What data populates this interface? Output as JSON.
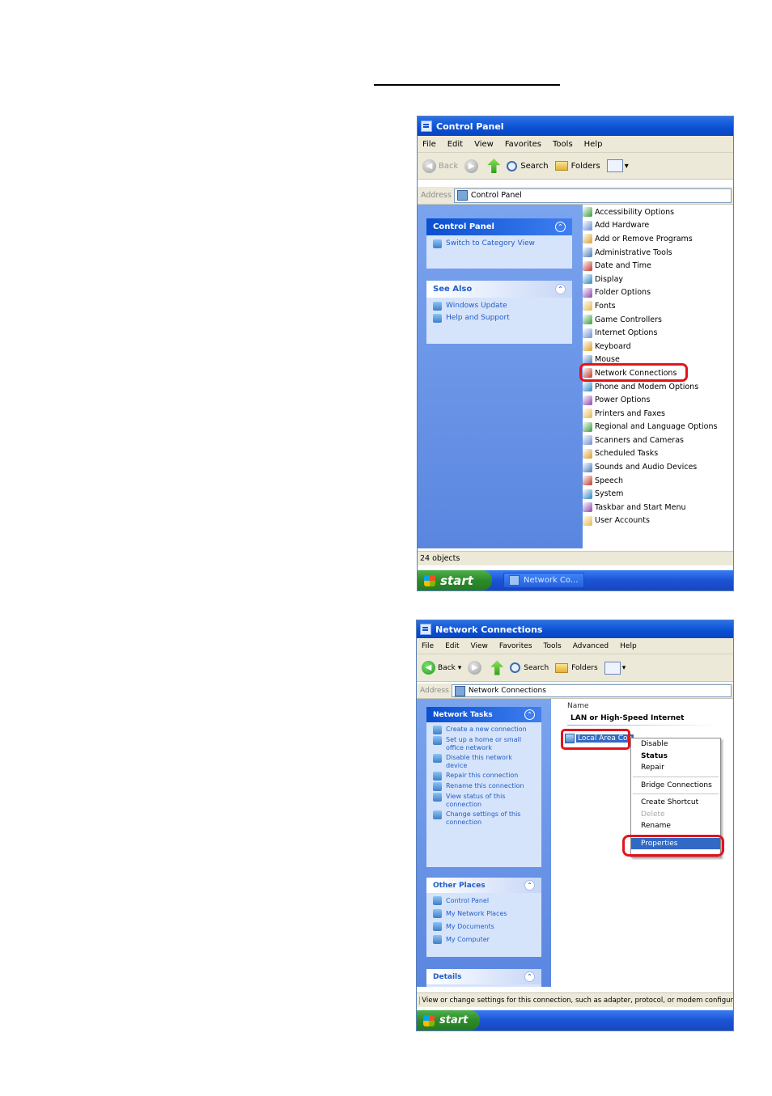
{
  "control_panel": {
    "title": "Control Panel",
    "menu": [
      "File",
      "Edit",
      "View",
      "Favorites",
      "Tools",
      "Help"
    ],
    "toolbar": {
      "back": "Back",
      "search": "Search",
      "folders": "Folders"
    },
    "address": {
      "label": "Address",
      "value": "Control Panel"
    },
    "sidebar": {
      "control_panel_header": "Control Panel",
      "switch_link": "Switch to Category View",
      "see_also_header": "See Also",
      "see_also_items": [
        "Windows Update",
        "Help and Support"
      ]
    },
    "items": [
      "Accessibility Options",
      "Add Hardware",
      "Add or Remove Programs",
      "Administrative Tools",
      "Date and Time",
      "Display",
      "Folder Options",
      "Fonts",
      "Game Controllers",
      "Internet Options",
      "Keyboard",
      "Mouse",
      "Network Connections",
      "Phone and Modem Options",
      "Power Options",
      "Printers and Faxes",
      "Regional and Language Options",
      "Scanners and Cameras",
      "Scheduled Tasks",
      "Sounds and Audio Devices",
      "Speech",
      "System",
      "Taskbar and Start Menu",
      "User Accounts"
    ],
    "status": "24 objects",
    "taskbar": {
      "start": "start",
      "task": "Network Co..."
    }
  },
  "network_connections": {
    "title": "Network Connections",
    "menu": [
      "File",
      "Edit",
      "View",
      "Favorites",
      "Tools",
      "Advanced",
      "Help"
    ],
    "toolbar": {
      "back": "Back",
      "search": "Search",
      "folders": "Folders"
    },
    "address": {
      "label": "Address",
      "value": "Network Connections"
    },
    "sidebar": {
      "network_tasks_header": "Network Tasks",
      "network_tasks": [
        "Create a new connection",
        "Set up a home or small office network",
        "Disable this network device",
        "Repair this connection",
        "Rename this connection",
        "View status of this connection",
        "Change settings of this connection"
      ],
      "other_places_header": "Other Places",
      "other_places": [
        "Control Panel",
        "My Network Places",
        "My Documents",
        "My Computer"
      ],
      "details_header": "Details"
    },
    "column_header": "Name",
    "group_header": "LAN or High-Speed Internet",
    "selected_item": "Local Area Con",
    "context_menu": [
      "Disable",
      "Status",
      "Repair",
      "Bridge Connections",
      "Create Shortcut",
      "Delete",
      "Rename",
      "Properties"
    ],
    "status": "View or change settings for this connection, such as adapter, protocol, or modem configur",
    "taskbar": {
      "start": "start"
    }
  },
  "icon_colors": [
    "#3b9b3b",
    "#6b8fd1",
    "#d9a12b",
    "#4a7ab9",
    "#c0392b",
    "#2e86c1",
    "#8e44ad",
    "#e6b84b"
  ]
}
